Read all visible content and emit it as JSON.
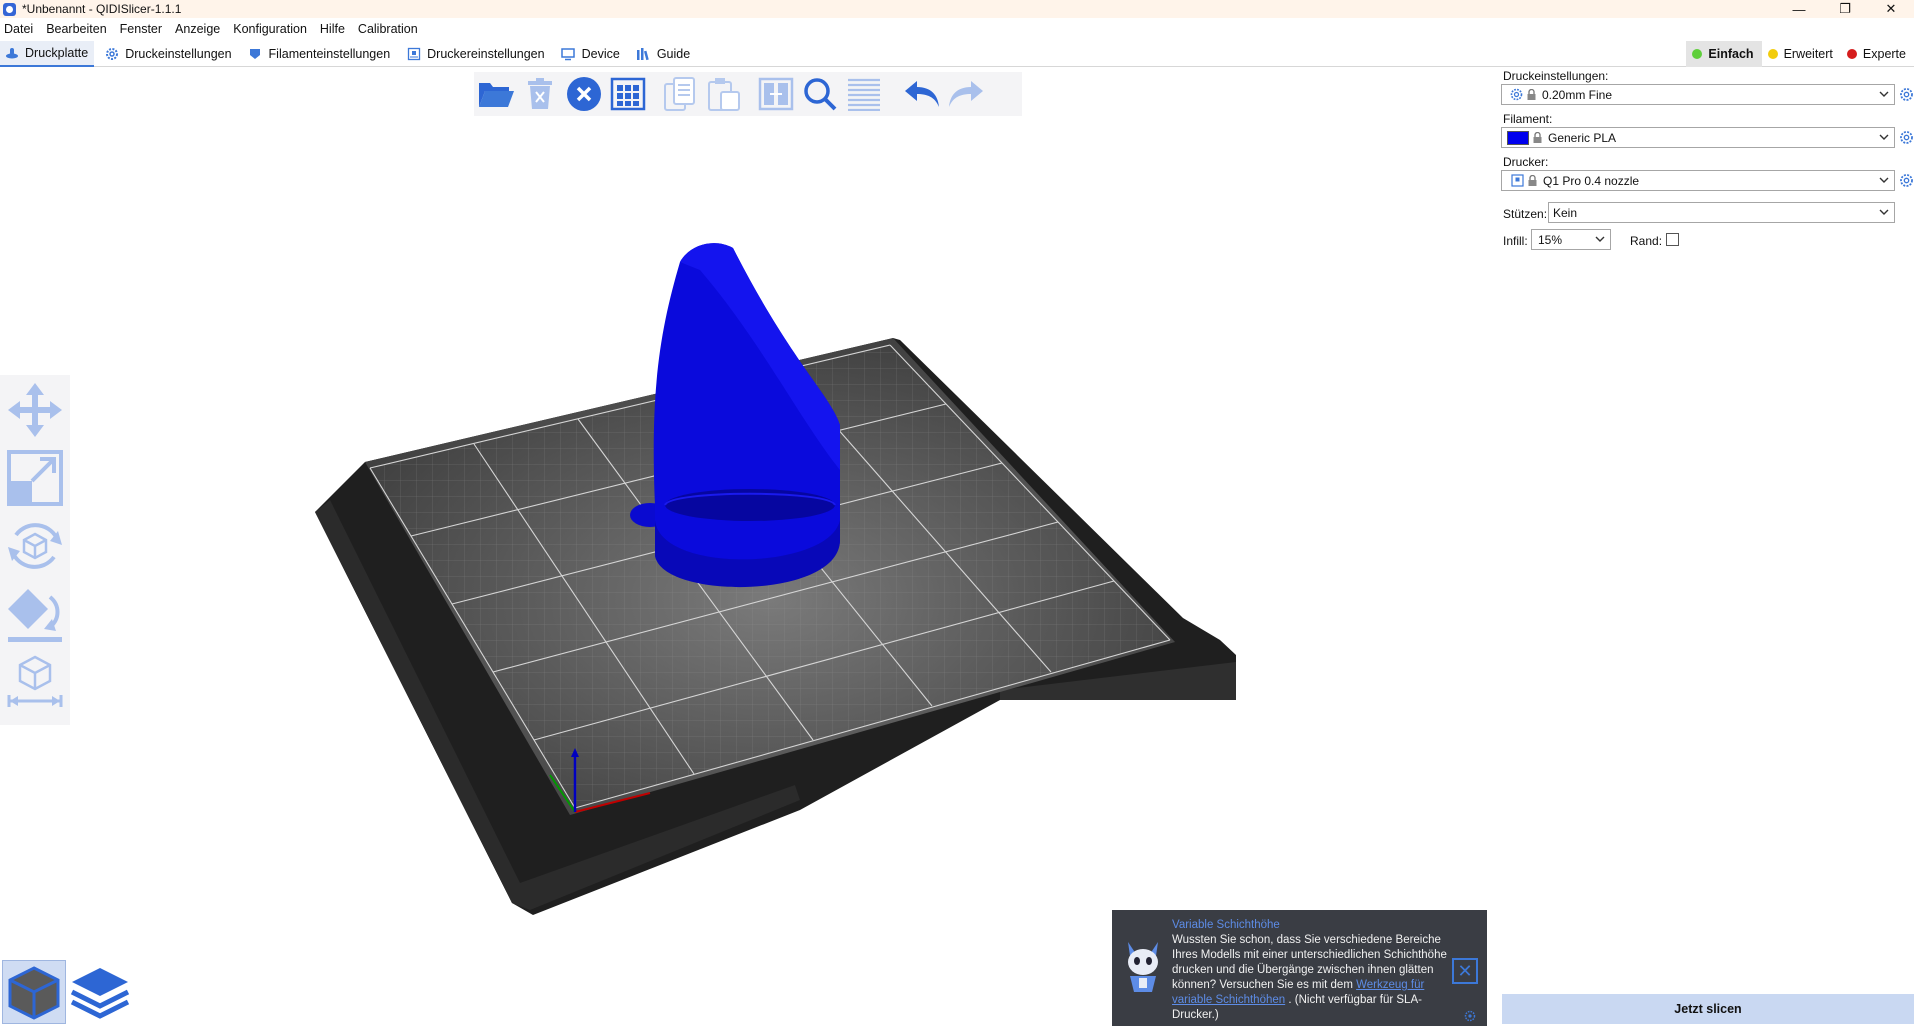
{
  "window": {
    "title": "*Unbenannt - QIDISlicer-1.1.1",
    "controls": [
      "minimize",
      "maximize",
      "close"
    ]
  },
  "menubar": {
    "items": [
      "Datei",
      "Bearbeiten",
      "Fenster",
      "Anzeige",
      "Konfiguration",
      "Hilfe",
      "Calibration"
    ]
  },
  "tabs": [
    {
      "label": "Druckplatte",
      "icon": "plate-icon",
      "active": true
    },
    {
      "label": "Druckeinstellungen",
      "icon": "gear-icon",
      "active": false
    },
    {
      "label": "Filamenteinstellungen",
      "icon": "spool-icon",
      "active": false
    },
    {
      "label": "Druckereinstellungen",
      "icon": "printer-icon",
      "active": false
    },
    {
      "label": "Device",
      "icon": "device-icon",
      "active": false
    },
    {
      "label": "Guide",
      "icon": "guide-icon",
      "active": false
    }
  ],
  "modes": [
    {
      "label": "Einfach",
      "color": "#5fcf3b",
      "active": true
    },
    {
      "label": "Erweitert",
      "color": "#f2cc0c",
      "active": false
    },
    {
      "label": "Experte",
      "color": "#d51d1d",
      "active": false
    }
  ],
  "toolbar": {
    "buttons": [
      "open-folder-icon",
      "delete-icon",
      "delete-all-icon",
      "arrange-icon",
      "copy-icon",
      "paste-icon",
      "split-objects-icon",
      "search-icon",
      "layers-editing-icon",
      "undo-icon",
      "redo-icon"
    ]
  },
  "left_tools": [
    "move-icon",
    "scale-icon",
    "rotate-icon",
    "place-on-face-icon",
    "cut-icon"
  ],
  "view_buttons": [
    "3d-view-icon",
    "preview-layers-icon"
  ],
  "sidebar": {
    "print_settings_label": "Druckeinstellungen:",
    "print_settings_value": "0.20mm Fine",
    "filament_label": "Filament:",
    "filament_value": "Generic PLA",
    "filament_color": "#0000ee",
    "printer_label": "Drucker:",
    "printer_value": "Q1 Pro 0.4 nozzle",
    "supports_label": "Stützen:",
    "supports_value": "Kein",
    "infill_label": "Infill:",
    "infill_value": "15%",
    "brim_label": "Rand:",
    "brim_checked": false,
    "slice_button": "Jetzt slicen"
  },
  "notification": {
    "title": "Variable Schichthöhe",
    "body": "Wussten Sie schon, dass Sie verschiedene Bereiche Ihres Modells mit einer unterschiedlichen Schichthöhe drucken und die Übergänge zwischen ihnen glätten können? Versuchen Sie es mit dem",
    "link": "Werkzeug für variable Schichthöhen",
    "tail": ". (Nicht verfügbar für SLA-Drucker.)"
  },
  "scene": {
    "model_color": "#0a0adc",
    "bed_color": "#2a2a2a"
  }
}
